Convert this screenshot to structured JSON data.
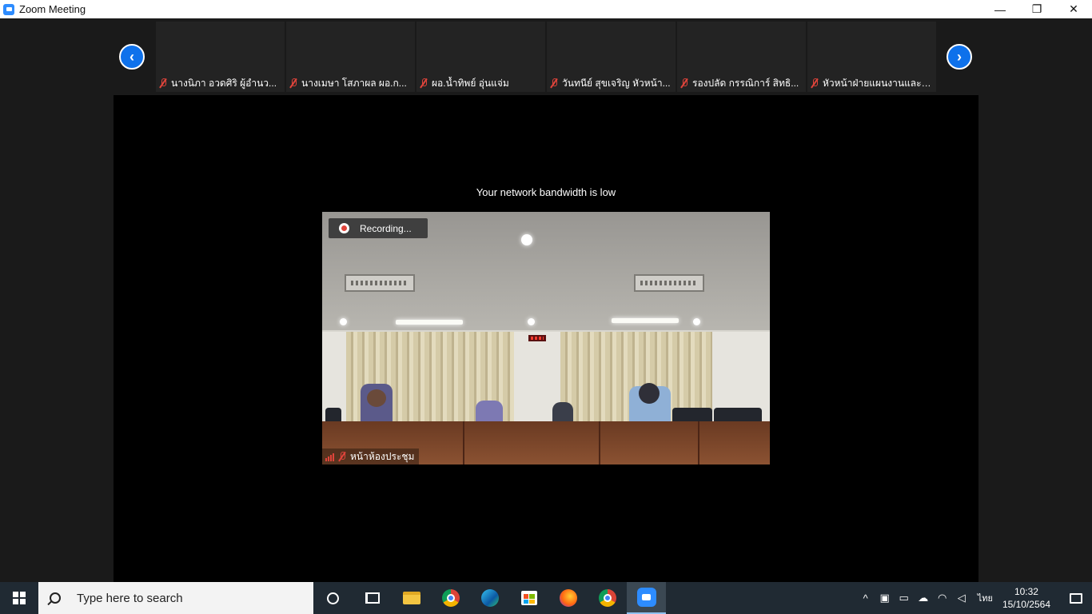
{
  "window": {
    "title": "Zoom Meeting",
    "minimize_glyph": "—",
    "restore_glyph": "❐",
    "close_glyph": "✕"
  },
  "strip": {
    "prev_glyph": "‹",
    "next_glyph": "›",
    "participants": [
      {
        "name": "นางนิภา อวดศิริ  ผู้อำนว...",
        "muted": true
      },
      {
        "name": "นางเมษา  โสภาผล ผอ.ก...",
        "muted": true
      },
      {
        "name": "ผอ.น้ำทิพย์ อุ่นแจ่ม",
        "muted": true
      },
      {
        "name": "วันทนีย์ สุขเจริญ หัวหน้า...",
        "muted": true
      },
      {
        "name": "รองปลัด กรรณิการ์  สิทธิ...",
        "muted": true
      },
      {
        "name": "หัวหน้าฝ่ายแผนงานและง...",
        "muted": true
      }
    ]
  },
  "stage": {
    "notice": "Your network bandwidth is low",
    "recording_label": "Recording...",
    "active_speaker": "หน้าห้องประชุม",
    "active_speaker_muted": true
  },
  "taskbar": {
    "search_placeholder": "Type here to search",
    "apps": [
      "cortana",
      "task-view",
      "file-explorer",
      "chrome",
      "edge",
      "microsoft-store",
      "firefox",
      "chrome-profile",
      "zoom"
    ],
    "active_app": "zoom",
    "tray": {
      "chevron": "^",
      "language": "ไทย",
      "time": "10:32",
      "date": "15/10/2564"
    }
  },
  "colors": {
    "accent": "#0e71eb",
    "mute_red": "#e0443b",
    "taskbar_bg": "#202a33"
  }
}
